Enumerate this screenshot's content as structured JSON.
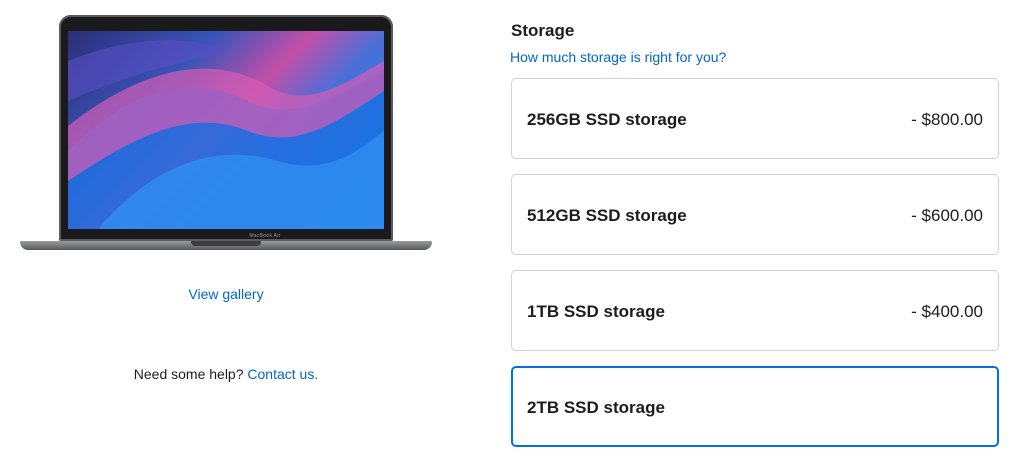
{
  "product": {
    "image_alt": "MacBook Air",
    "brand_text": "MacBook Air",
    "gallery_link": "View gallery",
    "help_text": "Need some help?",
    "help_link": "Contact us."
  },
  "storage": {
    "title": "Storage",
    "info_link": "How much storage is right for you?",
    "options": [
      {
        "label": "256GB SSD storage",
        "price": "- $800.00",
        "selected": false
      },
      {
        "label": "512GB SSD storage",
        "price": "- $600.00",
        "selected": false
      },
      {
        "label": "1TB SSD storage",
        "price": "- $400.00",
        "selected": false
      },
      {
        "label": "2TB SSD storage",
        "price": "",
        "selected": true
      }
    ]
  },
  "colors": {
    "link": "#0066cc",
    "selected_border": "#0071e3",
    "border": "#d2d2d7",
    "text": "#1d1d1f"
  }
}
